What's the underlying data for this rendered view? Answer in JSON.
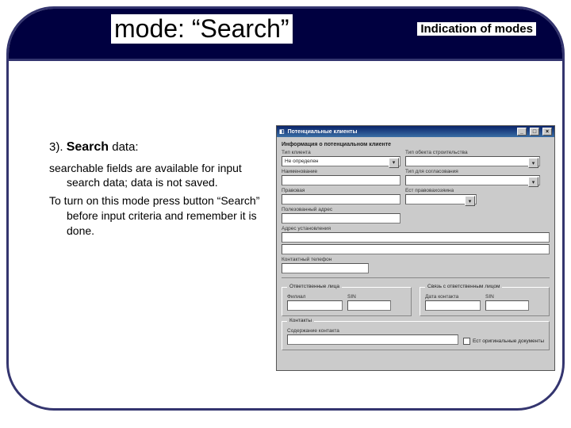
{
  "header": {
    "title": "mode: “Search”",
    "subtitle": "Indication of modes"
  },
  "body": {
    "heading_prefix": "3). ",
    "heading_bold": "Search",
    "heading_suffix": " data:",
    "p1": "searchable fields are available for input search data; data is not saved.",
    "p2": "To turn on this mode press button “Search” before input criteria and remember it is done."
  },
  "screenshot": {
    "window_title": "Потенциальные клиенты",
    "section1": "Информация о потенциальном клиенте",
    "labels": {
      "tip_klienta": "Тип клиента",
      "tip_klienta_value": "Не определен",
      "tip_obekta": "Тип обекта строительства",
      "naimenovanie": "Наименование",
      "tip_hint": "Тип для согласования",
      "pravovaia": "Правовая",
      "est_prava": "Ест правовахозяина",
      "polnoe": "Полезованный адрес",
      "adres": "Адрес установления",
      "kontaktnyi": "Контактный телефон",
      "otv_group": "Ответственные лица",
      "filial": "Филиал",
      "sin": "SIN",
      "svyaz_group": "Связь с ответственным лицом",
      "data_kontakta": "Дата контакта",
      "sin2": "SIN",
      "kontakty_group": "Контакты",
      "soderzhanie": "Содержание контакта",
      "est_dokument": "Ест оригинальные документы"
    }
  }
}
